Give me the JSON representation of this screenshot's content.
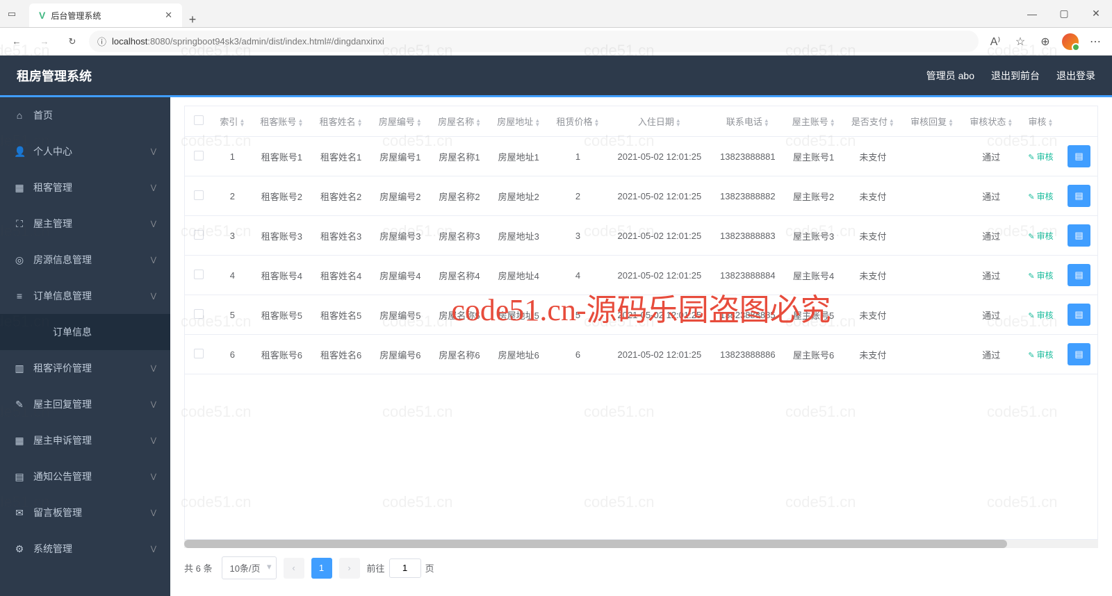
{
  "browser": {
    "tab_title": "后台管理系统",
    "url_host": "localhost",
    "url_port": ":8080",
    "url_path": "/springboot94sk3/admin/dist/index.html#/dingdanxinxi"
  },
  "header": {
    "app_title": "租房管理系统",
    "user_label": "管理员 abo",
    "to_front": "退出到前台",
    "logout": "退出登录"
  },
  "sidebar": {
    "items": [
      {
        "icon": "⌂",
        "label": "首页",
        "expandable": false
      },
      {
        "icon": "👤",
        "label": "个人中心",
        "expandable": true
      },
      {
        "icon": "▦",
        "label": "租客管理",
        "expandable": true
      },
      {
        "icon": "⛶",
        "label": "屋主管理",
        "expandable": true
      },
      {
        "icon": "◎",
        "label": "房源信息管理",
        "expandable": true
      },
      {
        "icon": "≡",
        "label": "订单信息管理",
        "expandable": true
      },
      {
        "icon": "",
        "label": "订单信息",
        "expandable": false,
        "sub": true
      },
      {
        "icon": "▥",
        "label": "租客评价管理",
        "expandable": true
      },
      {
        "icon": "✎",
        "label": "屋主回复管理",
        "expandable": true
      },
      {
        "icon": "▦",
        "label": "屋主申诉管理",
        "expandable": true
      },
      {
        "icon": "▤",
        "label": "通知公告管理",
        "expandable": true
      },
      {
        "icon": "✉",
        "label": "留言板管理",
        "expandable": true
      },
      {
        "icon": "⚙",
        "label": "系统管理",
        "expandable": true
      }
    ]
  },
  "table": {
    "columns": [
      "",
      "索引",
      "租客账号",
      "租客姓名",
      "房屋编号",
      "房屋名称",
      "房屋地址",
      "租赁价格",
      "入住日期",
      "联系电话",
      "屋主账号",
      "是否支付",
      "审核回复",
      "审核状态",
      "审核",
      ""
    ],
    "audit_label": "审核",
    "rows": [
      {
        "idx": "1",
        "tenant_acc": "租客账号1",
        "tenant_name": "租客姓名1",
        "house_no": "房屋编号1",
        "house_name": "房屋名称1",
        "house_addr": "房屋地址1",
        "price": "1",
        "date": "2021-05-02 12:01:25",
        "phone": "13823888881",
        "owner_acc": "屋主账号1",
        "paid": "未支付",
        "reply": "",
        "status": "通过"
      },
      {
        "idx": "2",
        "tenant_acc": "租客账号2",
        "tenant_name": "租客姓名2",
        "house_no": "房屋编号2",
        "house_name": "房屋名称2",
        "house_addr": "房屋地址2",
        "price": "2",
        "date": "2021-05-02 12:01:25",
        "phone": "13823888882",
        "owner_acc": "屋主账号2",
        "paid": "未支付",
        "reply": "",
        "status": "通过"
      },
      {
        "idx": "3",
        "tenant_acc": "租客账号3",
        "tenant_name": "租客姓名3",
        "house_no": "房屋编号3",
        "house_name": "房屋名称3",
        "house_addr": "房屋地址3",
        "price": "3",
        "date": "2021-05-02 12:01:25",
        "phone": "13823888883",
        "owner_acc": "屋主账号3",
        "paid": "未支付",
        "reply": "",
        "status": "通过"
      },
      {
        "idx": "4",
        "tenant_acc": "租客账号4",
        "tenant_name": "租客姓名4",
        "house_no": "房屋编号4",
        "house_name": "房屋名称4",
        "house_addr": "房屋地址4",
        "price": "4",
        "date": "2021-05-02 12:01:25",
        "phone": "13823888884",
        "owner_acc": "屋主账号4",
        "paid": "未支付",
        "reply": "",
        "status": "通过"
      },
      {
        "idx": "5",
        "tenant_acc": "租客账号5",
        "tenant_name": "租客姓名5",
        "house_no": "房屋编号5",
        "house_name": "房屋名称5",
        "house_addr": "房屋地址5",
        "price": "5",
        "date": "2021-05-02 12:01:25",
        "phone": "13823888885",
        "owner_acc": "屋主账号5",
        "paid": "未支付",
        "reply": "",
        "status": "通过"
      },
      {
        "idx": "6",
        "tenant_acc": "租客账号6",
        "tenant_name": "租客姓名6",
        "house_no": "房屋编号6",
        "house_name": "房屋名称6",
        "house_addr": "房屋地址6",
        "price": "6",
        "date": "2021-05-02 12:01:25",
        "phone": "13823888886",
        "owner_acc": "屋主账号6",
        "paid": "未支付",
        "reply": "",
        "status": "通过"
      }
    ]
  },
  "pagination": {
    "total_text": "共 6 条",
    "per_page": "10条/页",
    "current": "1",
    "jump_prefix": "前往",
    "jump_value": "1",
    "jump_suffix": "页"
  },
  "watermark": {
    "main": "code51.cn-源码乐园盗图必究",
    "bg": "code51.cn"
  }
}
